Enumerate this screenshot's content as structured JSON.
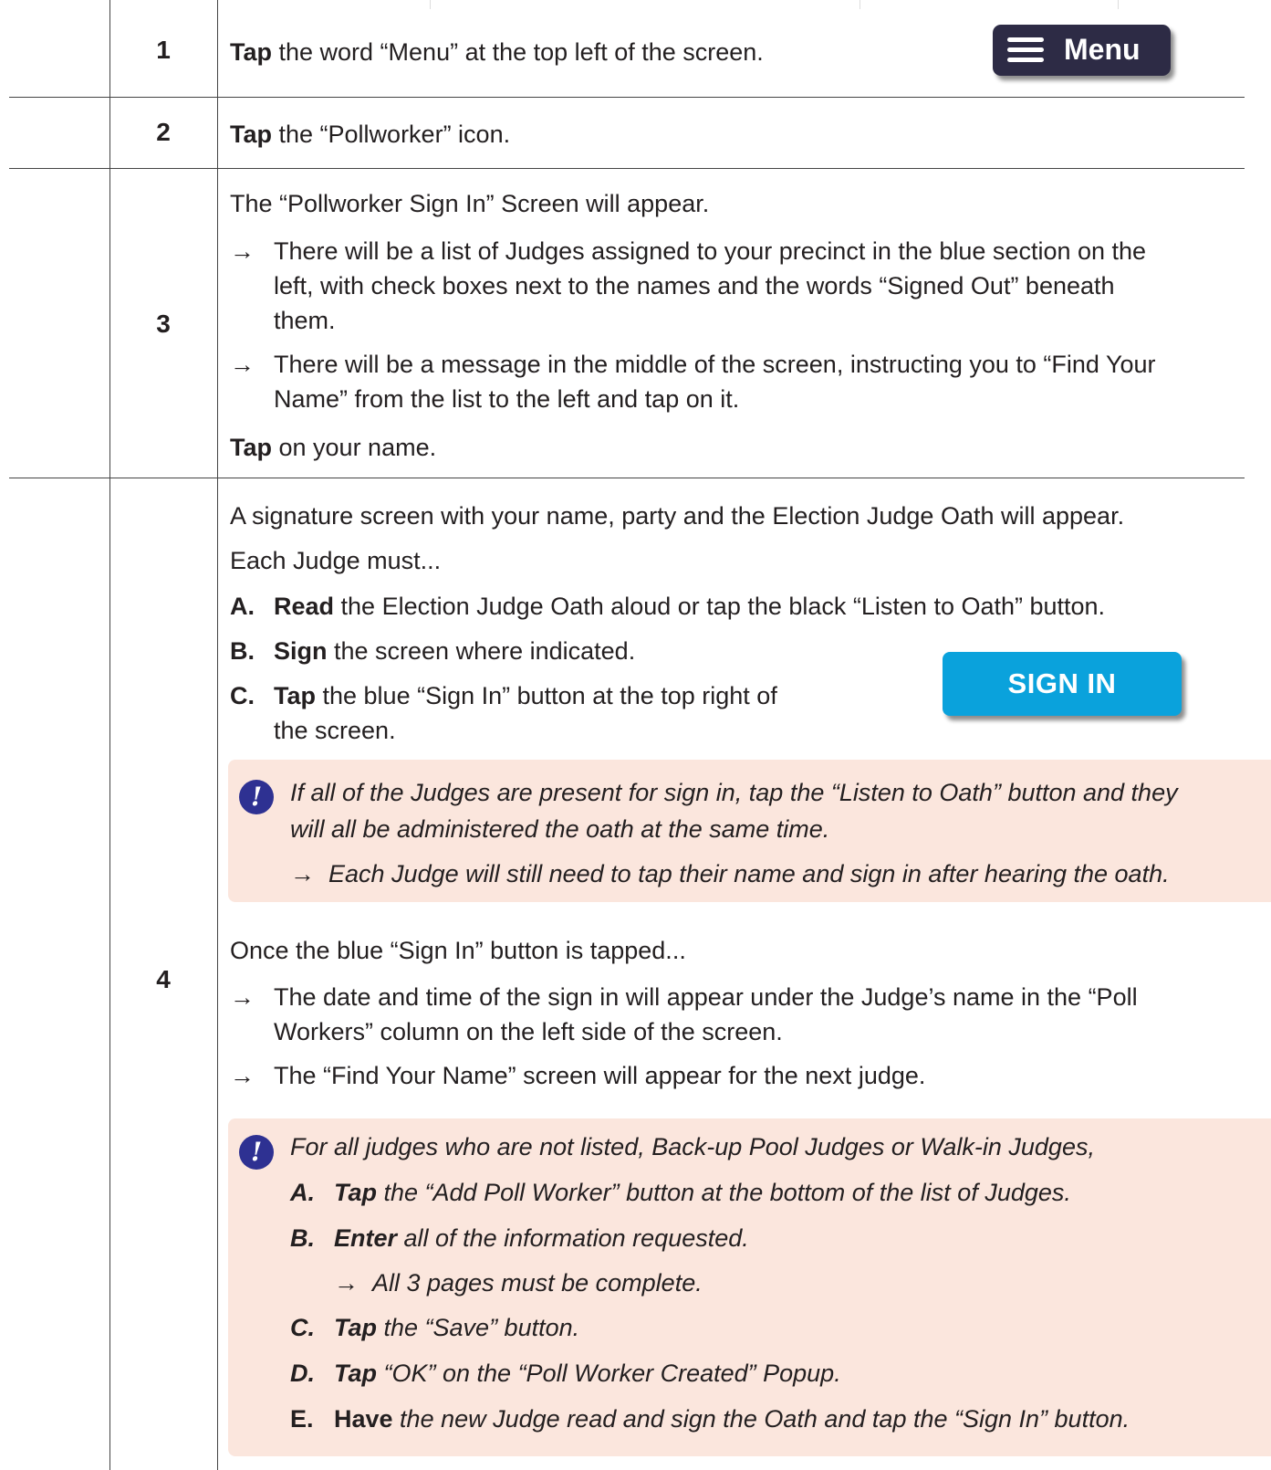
{
  "rows": [
    {
      "number": "1",
      "bold": "Tap",
      "text": " the word “Menu” at the top left of the screen.",
      "button_label": "Menu"
    },
    {
      "number": "2",
      "bold": "Tap",
      "text": " the “Pollworker” icon."
    },
    {
      "number": "3",
      "intro": "The “Pollworker Sign In” Screen will appear.",
      "bullets": [
        [
          "There will be a list of Judges assigned to your precinct in the blue section on the",
          "left, with check boxes next to the names and the words “Signed Out” beneath",
          "them."
        ],
        [
          "There will be a message in the middle of the screen, instructing you to “Find Your",
          "Name” from the list to the left and tap on it."
        ]
      ],
      "final_bold": "Tap",
      "final_text": " on your name."
    },
    {
      "number": "4",
      "intro": "A signature screen with your name, party and the Election Judge Oath will appear.",
      "intro2": "Each Judge must...",
      "steps": [
        {
          "letter": "A.",
          "bold": "Read",
          "text": " the Election Judge Oath aloud or tap the black “Listen to Oath” button."
        },
        {
          "letter": "B.",
          "bold": "Sign",
          "text": " the screen where indicated."
        },
        {
          "letter": "C.",
          "bold": "Tap",
          "text": " the blue “Sign In” button at the top right of",
          "text2": "the screen."
        }
      ],
      "signin_label": "SIGN IN",
      "note1": {
        "icon": "!",
        "line1": "If all of the Judges are present for sign in, tap the “Listen to Oath” button and they",
        "line2": "will all be administered the oath at the same time.",
        "bullet": "Each Judge will still need to tap their name and sign in after hearing the oath."
      },
      "after_intro": "Once the blue “Sign In” button is tapped...",
      "after_bullets": [
        [
          "The date and time of the sign in will appear under the Judge’s name in the “Poll",
          "Workers” column on the left side of the screen."
        ],
        [
          "The “Find Your Name” screen will appear for the next judge."
        ]
      ],
      "note2": {
        "icon": "!",
        "intro": "For all judges who are not listed, Back-up Pool Judges or Walk-in Judges,",
        "steps": [
          {
            "letter": "A.",
            "bold": "Tap",
            "text": " the “Add Poll Worker” button at the bottom of the list of Judges."
          },
          {
            "letter": "B.",
            "bold": "Enter",
            "text": " all of the information requested."
          },
          {
            "letter": "C.",
            "bold": "Tap",
            "text": " the “Save” button."
          },
          {
            "letter": "D.",
            "bold": "Tap",
            "text": " “OK” on the “Poll Worker Created” Popup."
          },
          {
            "letter": "E.",
            "bold": "Have",
            "text": " the new Judge read and sign the Oath and tap the “Sign In” button."
          }
        ],
        "sub_bullet": "All 3 pages must be complete."
      }
    }
  ],
  "arrow_glyph": "→"
}
